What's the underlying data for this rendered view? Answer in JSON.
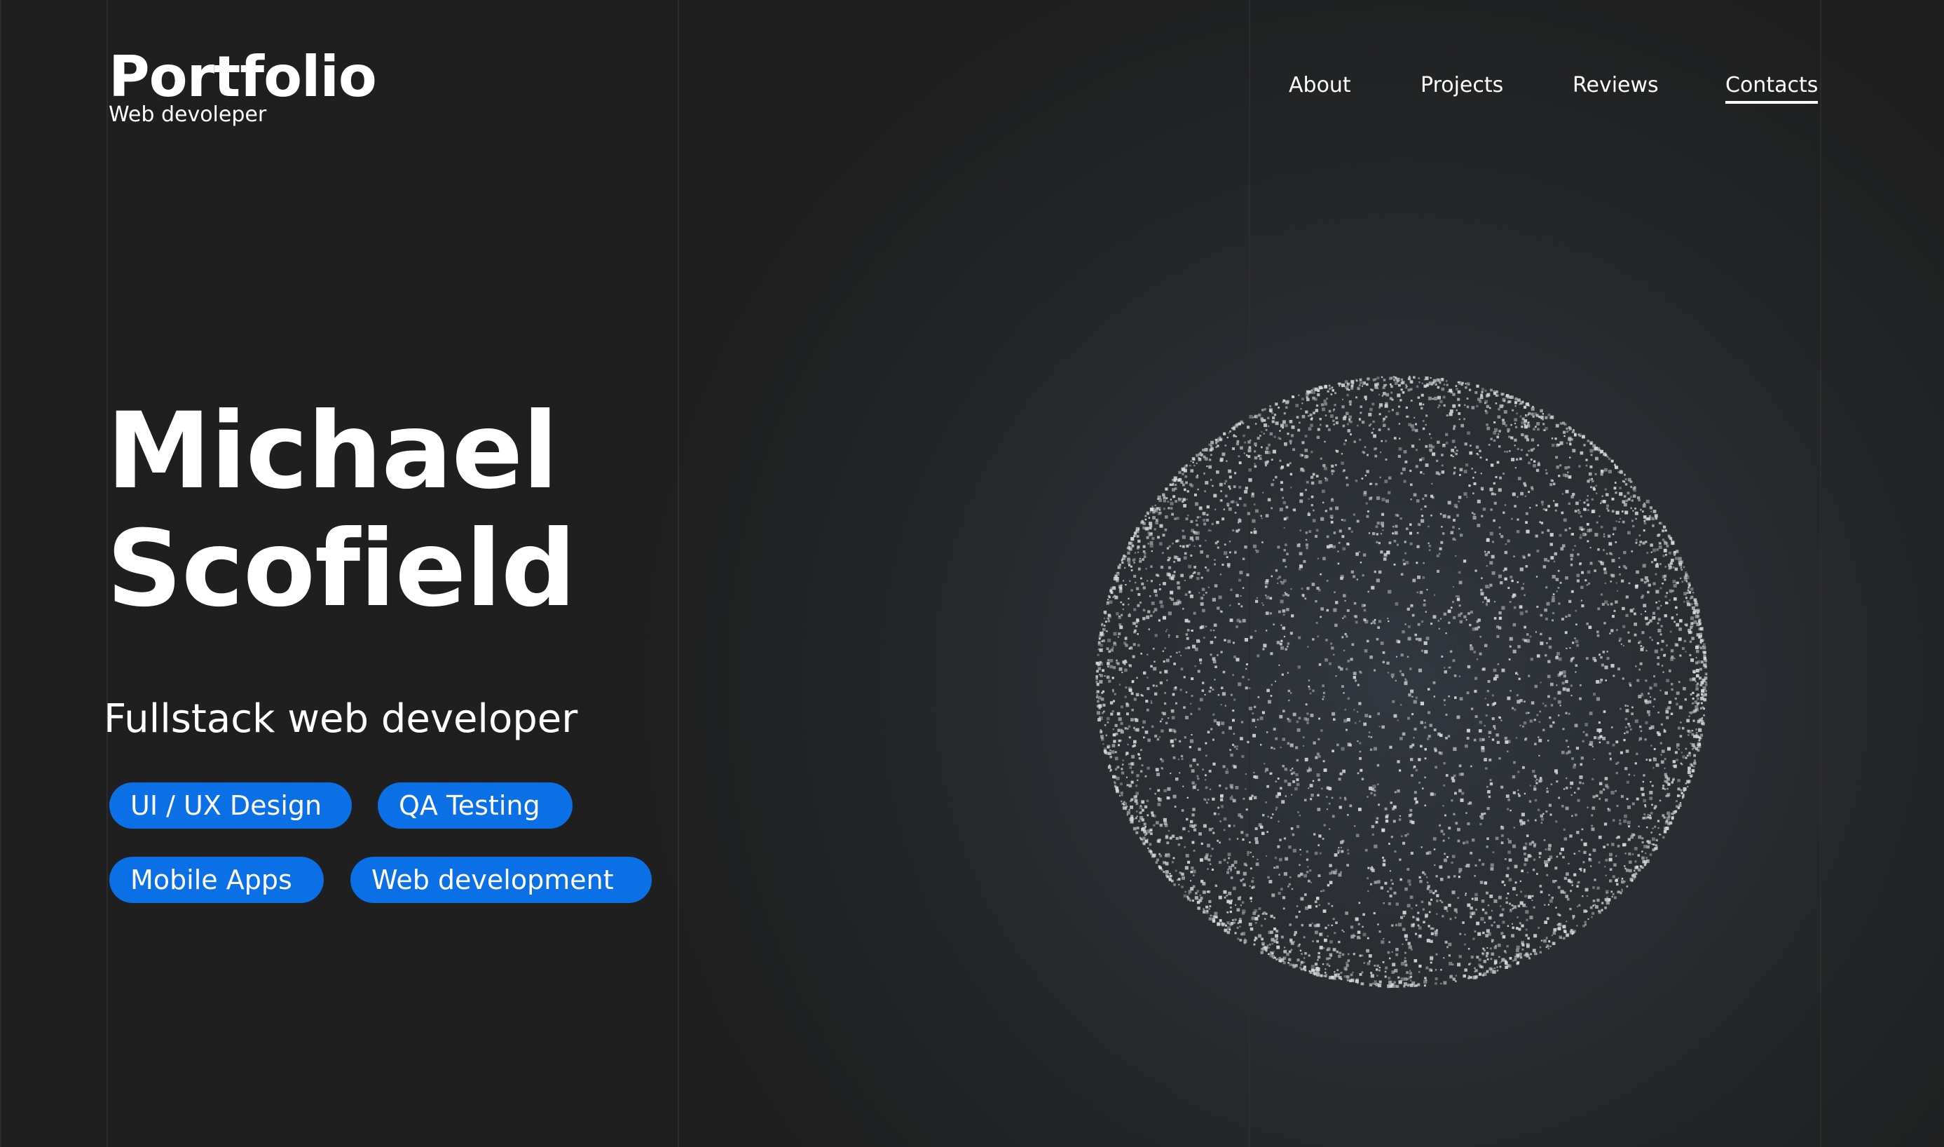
{
  "header": {
    "brand_title": "Portfolio",
    "brand_subtitle": "Web devoleper"
  },
  "nav": {
    "items": [
      {
        "label": "About",
        "active": false
      },
      {
        "label": "Projects",
        "active": false
      },
      {
        "label": "Reviews",
        "active": false
      },
      {
        "label": "Contacts",
        "active": true
      }
    ]
  },
  "hero": {
    "first_name": "Michael",
    "last_name": "Scofield",
    "role": "Fullstack web developer",
    "tags": [
      "UI / UX Design",
      "QA Testing",
      "Mobile Apps",
      "Web development"
    ]
  },
  "colors": {
    "background": "#1f1f1f",
    "accent": "#0b6fe6",
    "text": "#ffffff",
    "particles": "#d9d9d9"
  },
  "decor": {
    "sphere": "particle-sphere"
  }
}
